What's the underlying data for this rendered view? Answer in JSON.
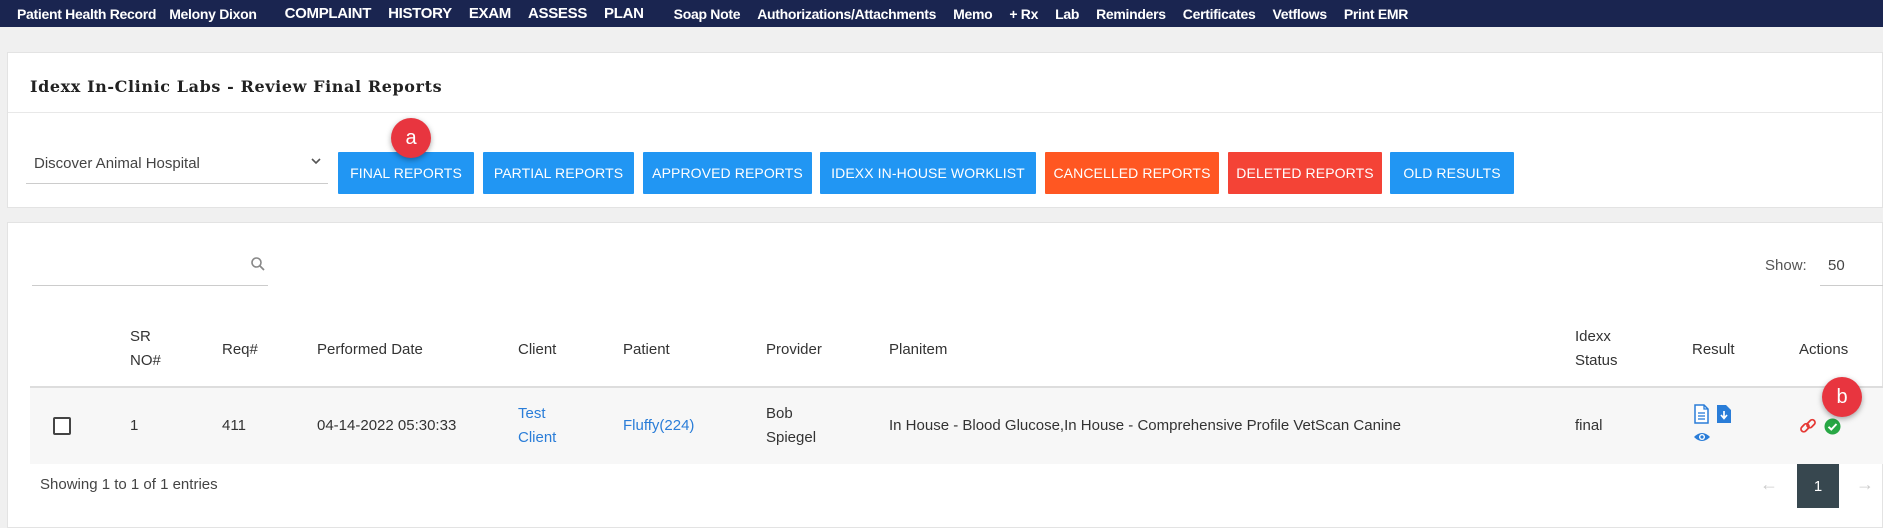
{
  "nav": {
    "brand": "Patient Health Record",
    "patient_name": "Melony Dixon",
    "items": [
      "COMPLAINT",
      "HISTORY",
      "EXAM",
      "ASSESS",
      "PLAN",
      "Soap Note",
      "Authorizations/Attachments",
      "Memo",
      "+ Rx",
      "Lab",
      "Reminders",
      "Certificates",
      "Vetflows",
      "Print EMR"
    ]
  },
  "panel": {
    "title": "Idexx In-Clinic Labs - Review Final Reports",
    "clinic_select": "Discover Animal Hospital",
    "buttons": {
      "final": "FINAL REPORTS",
      "partial": "PARTIAL REPORTS",
      "approved": "APPROVED REPORTS",
      "worklist": "IDEXX IN-HOUSE WORKLIST",
      "cancelled": "CANCELLED REPORTS",
      "deleted": "DELETED REPORTS",
      "old": "OLD RESULTS"
    }
  },
  "callouts": {
    "a": "a",
    "b": "b"
  },
  "table": {
    "search_value": "",
    "show_label": "Show:",
    "show_value": "50",
    "headers": {
      "sr_no_1": "SR",
      "sr_no_2": "NO#",
      "req": "Req#",
      "performed_date": "Performed Date",
      "client": "Client",
      "patient": "Patient",
      "provider": "Provider",
      "planitem": "Planitem",
      "idexx_1": "Idexx",
      "idexx_2": "Status",
      "result": "Result",
      "actions": "Actions"
    },
    "rows": [
      {
        "sr_no": "1",
        "req": "411",
        "performed_date": "04-14-2022 05:30:33",
        "client_1": "Test",
        "client_2": "Client",
        "patient": "Fluffy(224)",
        "provider_1": "Bob",
        "provider_2": "Spiegel",
        "planitem": "In House - Blood Glucose,In House - Comprehensive Profile VetScan Canine",
        "status": "final"
      }
    ],
    "footer": "Showing 1 to 1 of 1 entries",
    "pagination": {
      "prev": "←",
      "current": "1",
      "next": "→"
    }
  },
  "icons": [
    "document-icon",
    "download-icon",
    "eye-icon",
    "link-icon",
    "check-circle-icon",
    "search-icon",
    "chevron-down-icon"
  ],
  "colors": {
    "nav_bg": "#1a2550",
    "blue": "#2196f3",
    "orange": "#ff5722",
    "red": "#f44336",
    "link": "#2a7dd8",
    "callout": "#e8353f",
    "success": "#28a745"
  }
}
